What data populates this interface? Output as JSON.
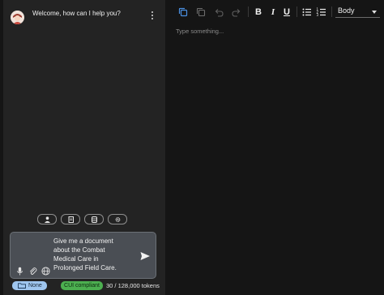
{
  "chat": {
    "welcome": "Welcome, how can I help you?",
    "composer_text": "Give me a document\nabout the Combat\nMedical Care in\nProlonged Field Care.",
    "quick_actions": [
      {
        "icon": "person-icon"
      },
      {
        "icon": "document-icon"
      },
      {
        "icon": "database-icon"
      },
      {
        "icon": "gear-icon"
      }
    ],
    "footer": {
      "folder_label": "None",
      "compliance_label": "CUI compliant",
      "tokens": "30 / 128,000 tokens"
    }
  },
  "editor": {
    "style_value": "Body",
    "placeholder": "Type something...",
    "toolbar": {
      "bold": "B",
      "italic": "I",
      "underline": "U"
    }
  },
  "colors": {
    "panel_bg": "#232323",
    "editor_bg": "#151515",
    "accent_blue": "#4a90e2",
    "pill_blue": "#9fc6ef",
    "pill_green": "#4caf50"
  }
}
